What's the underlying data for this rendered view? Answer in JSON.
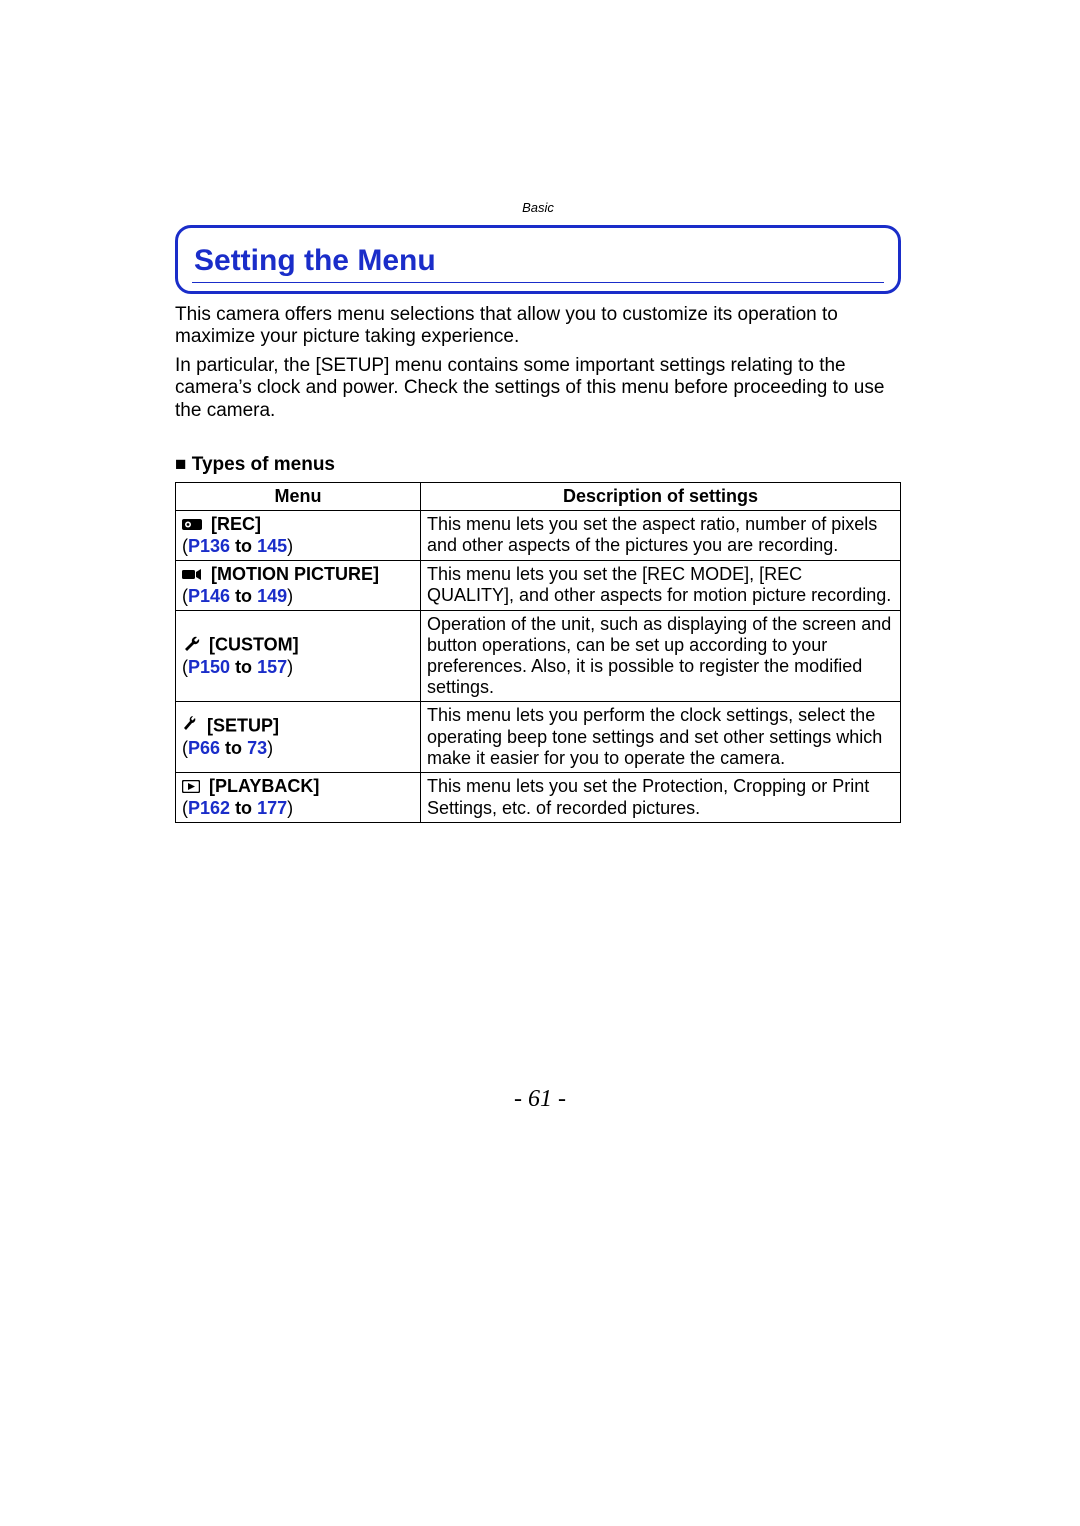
{
  "header": {
    "crumb": "Basic",
    "title": "Setting the Menu"
  },
  "intro": {
    "p1": "This camera offers menu selections that allow you to customize its operation to maximize your picture taking experience.",
    "p2": "In particular, the [SETUP] menu contains some important settings relating to the camera’s clock and power. Check the settings of this menu before proceeding to use the camera."
  },
  "subheader": "Types of menus",
  "table": {
    "col_menu": "Menu",
    "col_desc": "Description of settings",
    "rows": [
      {
        "name": "[REC]",
        "page_from": "P136",
        "to": "to",
        "page_to": "145",
        "desc": "This menu lets you set the aspect ratio, number of pixels and other aspects of the pictures you are recording."
      },
      {
        "name": "[MOTION PICTURE]",
        "page_from": "P146",
        "to": "to",
        "page_to": "149",
        "desc": "This menu lets you set the [REC MODE], [REC QUALITY], and other aspects for motion picture recording."
      },
      {
        "name": "[CUSTOM]",
        "page_from": "P150",
        "to": "to",
        "page_to": "157",
        "desc": "Operation of the unit, such as displaying of the screen and button operations, can be set up according to your preferences. Also, it is possible to register the modified settings."
      },
      {
        "name": "[SETUP]",
        "page_from": "P66",
        "to": "to",
        "page_to": "73",
        "desc": "This menu lets you perform the clock settings, select the operating beep tone settings and set other settings which make it easier for you to operate the camera."
      },
      {
        "name": "[PLAYBACK]",
        "page_from": "P162",
        "to": "to",
        "page_to": "177",
        "desc": "This menu lets you set the Protection, Cropping or Print Settings, etc. of recorded pictures."
      }
    ]
  },
  "page_number": "- 61 -"
}
